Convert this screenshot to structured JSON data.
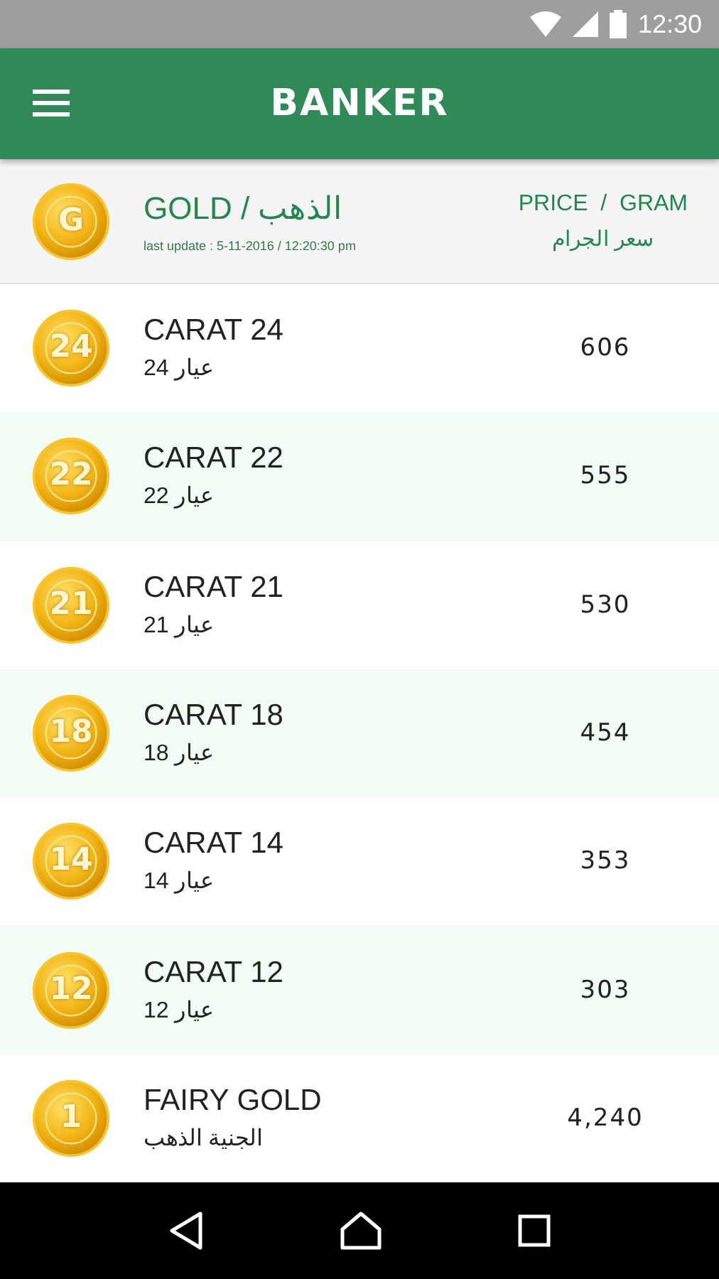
{
  "status_bar": {
    "time": "12:30"
  },
  "app_bar": {
    "title": "BANKER"
  },
  "header": {
    "coin_label": "G",
    "title": "GOLD / الذهب",
    "last_update": "last update : 5-11-2016 / 12:20:30 pm",
    "price_label": "PRICE  /  GRAM",
    "price_label_ar": "سعر الجرام"
  },
  "rows": [
    {
      "coin_label": "24",
      "name": "CARAT 24",
      "name_ar": "عيار 24",
      "price": "606"
    },
    {
      "coin_label": "22",
      "name": "CARAT 22",
      "name_ar": "عيار 22",
      "price": "555"
    },
    {
      "coin_label": "21",
      "name": "CARAT 21",
      "name_ar": "عيار 21",
      "price": "530"
    },
    {
      "coin_label": "18",
      "name": "CARAT 18",
      "name_ar": "عيار 18",
      "price": "454"
    },
    {
      "coin_label": "14",
      "name": "CARAT 14",
      "name_ar": "عيار 14",
      "price": "353"
    },
    {
      "coin_label": "12",
      "name": "CARAT 12",
      "name_ar": "عيار 12",
      "price": "303"
    },
    {
      "coin_label": "1",
      "name": "FAIRY GOLD",
      "name_ar": "الجنية الذهب",
      "price": "4,240"
    }
  ]
}
